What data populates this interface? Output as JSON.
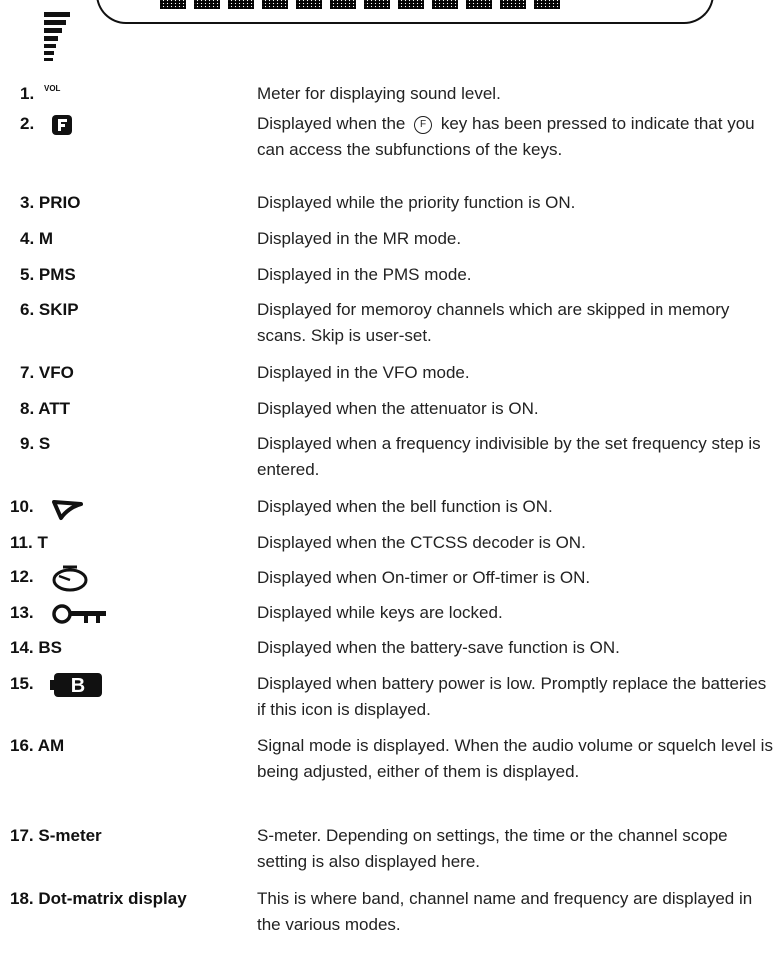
{
  "items": [
    {
      "num": "1.",
      "label": "",
      "icon": "volume-meter-icon",
      "lines": [
        "Meter for displaying sound level."
      ],
      "vol_label": "VOL"
    },
    {
      "num": "2.",
      "label": "",
      "icon": "f-key-icon",
      "pre": "Displayed when the",
      "key_label": "F",
      "post": "key has been pressed to indicate that you can access the subfunctions of the keys."
    },
    {
      "num": "3.",
      "label": "PRIO",
      "desc": "Displayed while the priority function is ON."
    },
    {
      "num": "4.",
      "label": "M",
      "desc": "Displayed in the MR mode."
    },
    {
      "num": "5.",
      "label": "PMS",
      "desc": "Displayed in the PMS mode."
    },
    {
      "num": "6.",
      "label": "SKIP",
      "desc": "Displayed for memoroy channels which are skipped in memory scans.  Skip is user-set."
    },
    {
      "num": "7.",
      "label": "VFO",
      "desc": "Displayed in the VFO mode."
    },
    {
      "num": "8.",
      "label": "ATT",
      "desc": "Displayed when the attenuator is ON."
    },
    {
      "num": "9.",
      "label": "S",
      "desc": "Displayed when a frequency indivisible by the set frequency step is entered."
    },
    {
      "num": "10.",
      "label": "",
      "icon": "bell-icon",
      "desc": "Displayed when the bell function is ON."
    },
    {
      "num": "11.",
      "label": "T",
      "desc": "Displayed when the CTCSS decoder is ON."
    },
    {
      "num": "12.",
      "label": "",
      "icon": "timer-icon",
      "desc": "Displayed when On-timer or Off-timer is ON."
    },
    {
      "num": "13.",
      "label": "",
      "icon": "key-lock-icon",
      "desc": "Displayed while keys are locked."
    },
    {
      "num": "14.",
      "label": "BS",
      "desc": "Displayed when the battery-save function is ON."
    },
    {
      "num": "15.",
      "label": "",
      "icon": "battery-low-icon",
      "icon_text": "B",
      "desc": "Displayed when battery power is low. Promptly replace the batteries if this icon is displayed."
    },
    {
      "num": "16.",
      "label": "AM",
      "desc": "Signal mode is displayed. When the audio volume or squelch level is being adjusted, either of them is displayed."
    },
    {
      "num": "17.",
      "label": "S-meter",
      "desc": "S-meter. Depending on settings, the time or the channel scope setting is also displayed here."
    },
    {
      "num": "18.",
      "label": "Dot-matrix display",
      "desc": "This is where band, channel name and frequency are displayed in the various modes."
    }
  ]
}
